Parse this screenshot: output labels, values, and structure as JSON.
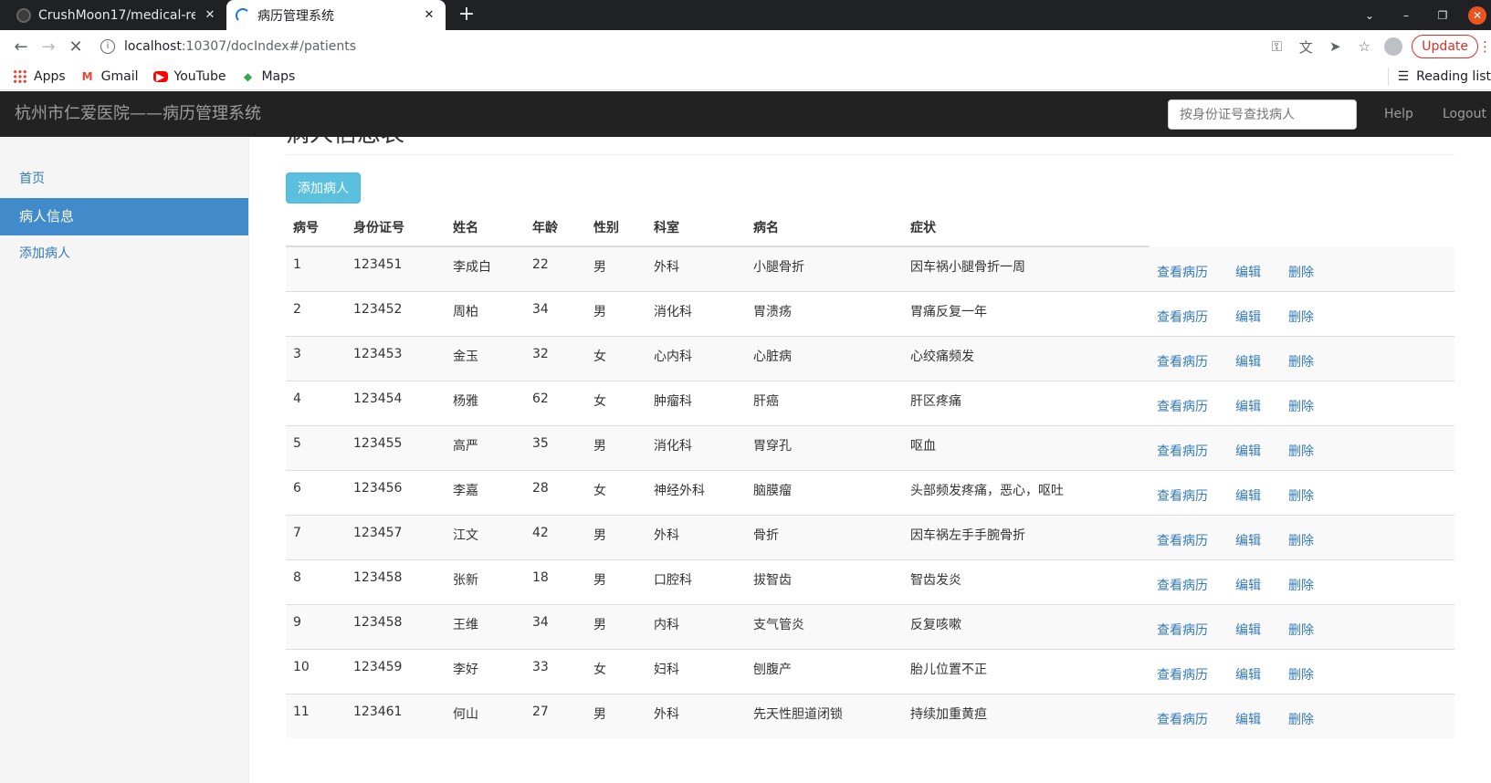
{
  "browser": {
    "tabs": [
      {
        "title": "CrushMoon17/medical-re"
      },
      {
        "title": "病历管理系统"
      }
    ],
    "url_host": "localhost",
    "url_path": ":10307/docIndex#/patients",
    "update_label": "Update",
    "bookmarks": [
      {
        "label": "Apps"
      },
      {
        "label": "Gmail"
      },
      {
        "label": "YouTube"
      },
      {
        "label": "Maps"
      }
    ],
    "reading_list": "Reading list"
  },
  "header": {
    "brand": "杭州市仁爱医院——病历管理系统",
    "search_placeholder": "按身份证号查找病人",
    "help": "Help",
    "logout": "Logout"
  },
  "sidebar": {
    "items": [
      {
        "label": "首页"
      },
      {
        "label": "病人信息"
      },
      {
        "label": "添加病人"
      }
    ]
  },
  "main": {
    "title": "病人信息表",
    "add_button": "添加病人",
    "columns": [
      "病号",
      "身份证号",
      "姓名",
      "年龄",
      "性别",
      "科室",
      "病名",
      "症状"
    ],
    "actions": {
      "view": "查看病历",
      "edit": "编辑",
      "delete": "删除"
    },
    "rows": [
      [
        "1",
        "123451",
        "李成白",
        "22",
        "男",
        "外科",
        "小腿骨折",
        "因车祸小腿骨折一周"
      ],
      [
        "2",
        "123452",
        "周柏",
        "34",
        "男",
        "消化科",
        "胃溃疡",
        "胃痛反复一年"
      ],
      [
        "3",
        "123453",
        "金玉",
        "32",
        "女",
        "心内科",
        "心脏病",
        "心绞痛频发"
      ],
      [
        "4",
        "123454",
        "杨雅",
        "62",
        "女",
        "肿瘤科",
        "肝癌",
        "肝区疼痛"
      ],
      [
        "5",
        "123455",
        "高严",
        "35",
        "男",
        "消化科",
        "胃穿孔",
        "呕血"
      ],
      [
        "6",
        "123456",
        "李嘉",
        "28",
        "女",
        "神经外科",
        "脑膜瘤",
        "头部频发疼痛，恶心，呕吐"
      ],
      [
        "7",
        "123457",
        "江文",
        "42",
        "男",
        "外科",
        "骨折",
        "因车祸左手手腕骨折"
      ],
      [
        "8",
        "123458",
        "张新",
        "18",
        "男",
        "口腔科",
        "拔智齿",
        "智齿发炎"
      ],
      [
        "9",
        "123458",
        "王维",
        "34",
        "男",
        "内科",
        "支气管炎",
        "反复咳嗽"
      ],
      [
        "10",
        "123459",
        "李好",
        "33",
        "女",
        "妇科",
        "刨腹产",
        "胎儿位置不正"
      ],
      [
        "11",
        "123461",
        "何山",
        "27",
        "男",
        "外科",
        "先天性胆道闭锁",
        "持续加重黄疸"
      ]
    ]
  }
}
